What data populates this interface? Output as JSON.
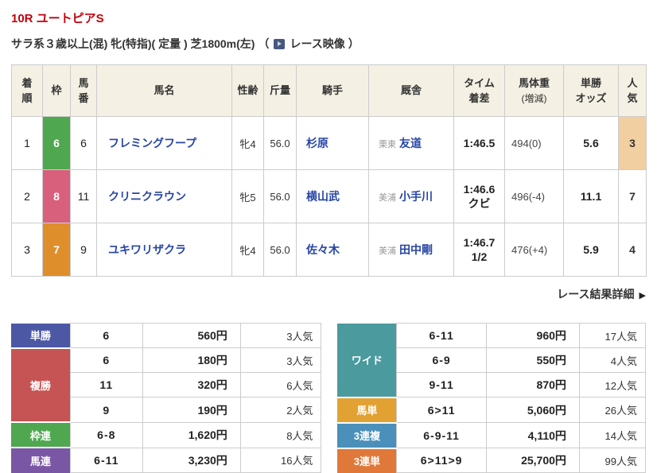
{
  "race": {
    "title": "10R ユートピアS",
    "conditions": "サラ系３歳以上(混) 牝(特指)( 定量 ) 芝1800m(左)",
    "video_open": "（",
    "video_label": "レース映像",
    "video_close": "）",
    "details_link": "レース結果詳細",
    "details_arrow": "▶"
  },
  "colors": {
    "title_red": "#c2000b",
    "link_blue": "#2745a5",
    "header_beige": "#f4f0e3",
    "border_gray": "#cccccc",
    "pop_highlight": "#f2cfa0"
  },
  "results": {
    "headers": {
      "rank": "着\n順",
      "waku": "枠",
      "num": "馬\n番",
      "name": "馬名",
      "sexage": "性齢",
      "weight": "斤量",
      "jockey": "騎手",
      "stable": "厩舎",
      "time": "タイム\n着差",
      "body_main": "馬体重",
      "body_sub": "(増減)",
      "odds": "単勝\nオッズ",
      "pop": "人\n気"
    },
    "rows": [
      {
        "rank": "1",
        "waku": "6",
        "waku_color": "#4fa74f",
        "num": "6",
        "name": "フレミングフープ",
        "sexage": "牝4",
        "weight": "56.0",
        "jockey": "杉原",
        "region": "栗東",
        "trainer": "友道",
        "time": "1:46.5",
        "body": "494(0)",
        "odds": "5.6",
        "pop": "3",
        "pop_bg": "#f2cfa0"
      },
      {
        "rank": "2",
        "waku": "8",
        "waku_color": "#d8607c",
        "num": "11",
        "name": "クリニクラウン",
        "sexage": "牝5",
        "weight": "56.0",
        "jockey": "横山武",
        "region": "美浦",
        "trainer": "小手川",
        "time": "1:46.6\nクビ",
        "body": "496(-4)",
        "odds": "11.1",
        "pop": "7",
        "pop_bg": ""
      },
      {
        "rank": "3",
        "waku": "7",
        "waku_color": "#de8e2b",
        "num": "9",
        "name": "ユキワリザクラ",
        "sexage": "牝4",
        "weight": "56.0",
        "jockey": "佐々木",
        "region": "美浦",
        "trainer": "田中剛",
        "time": "1:46.7\n1/2",
        "body": "476(+4)",
        "odds": "5.9",
        "pop": "4",
        "pop_bg": ""
      }
    ]
  },
  "payouts": {
    "left": {
      "rows": [
        {
          "label": "単勝",
          "color": "#4d58a5",
          "combo": "6",
          "amount": "560円",
          "pop": "3人気"
        },
        {
          "label": "複勝",
          "color": "#c75454",
          "combo": "6",
          "amount": "180円",
          "pop": "3人気"
        },
        {
          "combo": "11",
          "amount": "320円",
          "pop": "6人気"
        },
        {
          "combo": "9",
          "amount": "190円",
          "pop": "2人気"
        },
        {
          "label": "枠連",
          "color": "#4fa74f",
          "combo": "6-8",
          "amount": "1,620円",
          "pop": "8人気"
        },
        {
          "label": "馬連",
          "color": "#7a57a5",
          "combo": "6-11",
          "amount": "3,230円",
          "pop": "16人気"
        }
      ]
    },
    "right": {
      "rows": [
        {
          "label": "ワイド",
          "color": "#4a9a9e",
          "combo": "6-11",
          "amount": "960円",
          "pop": "17人気"
        },
        {
          "combo": "6-9",
          "amount": "550円",
          "pop": "4人気"
        },
        {
          "combo": "9-11",
          "amount": "870円",
          "pop": "12人気"
        },
        {
          "label": "馬単",
          "color": "#e2a233",
          "combo": "6>11",
          "amount": "5,060円",
          "pop": "26人気"
        },
        {
          "label": "3連複",
          "color": "#4a90ba",
          "combo": "6-9-11",
          "amount": "4,110円",
          "pop": "14人気"
        },
        {
          "label": "3連単",
          "color": "#e0783a",
          "combo": "6>11>9",
          "amount": "25,700円",
          "pop": "99人気"
        }
      ]
    }
  }
}
